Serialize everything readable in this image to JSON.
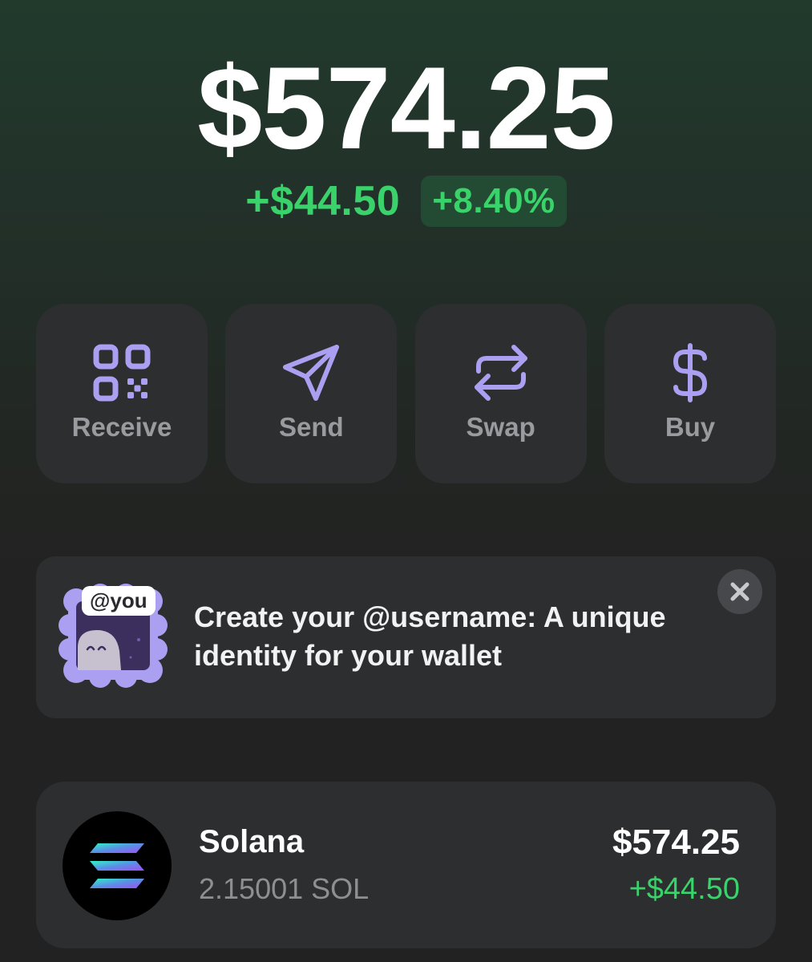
{
  "balance": {
    "total": "$574.25",
    "change_amount": "+$44.50",
    "change_percent": "+8.40%"
  },
  "actions": [
    {
      "label": "Receive",
      "icon": "qr-code-icon"
    },
    {
      "label": "Send",
      "icon": "send-icon"
    },
    {
      "label": "Swap",
      "icon": "swap-icon"
    },
    {
      "label": "Buy",
      "icon": "dollar-icon"
    }
  ],
  "banner": {
    "tag": "@you",
    "text": "Create your @username: A unique identity for your wallet",
    "close_icon": "close-icon"
  },
  "tokens": [
    {
      "name": "Solana",
      "amount": "2.15001 SOL",
      "value": "$574.25",
      "change": "+$44.50",
      "icon": "solana-logo"
    }
  ],
  "colors": {
    "accent": "#ab9ff2",
    "positive": "#3ad26a",
    "card": "#2c2e30",
    "muted_text": "#9a9b9e"
  }
}
